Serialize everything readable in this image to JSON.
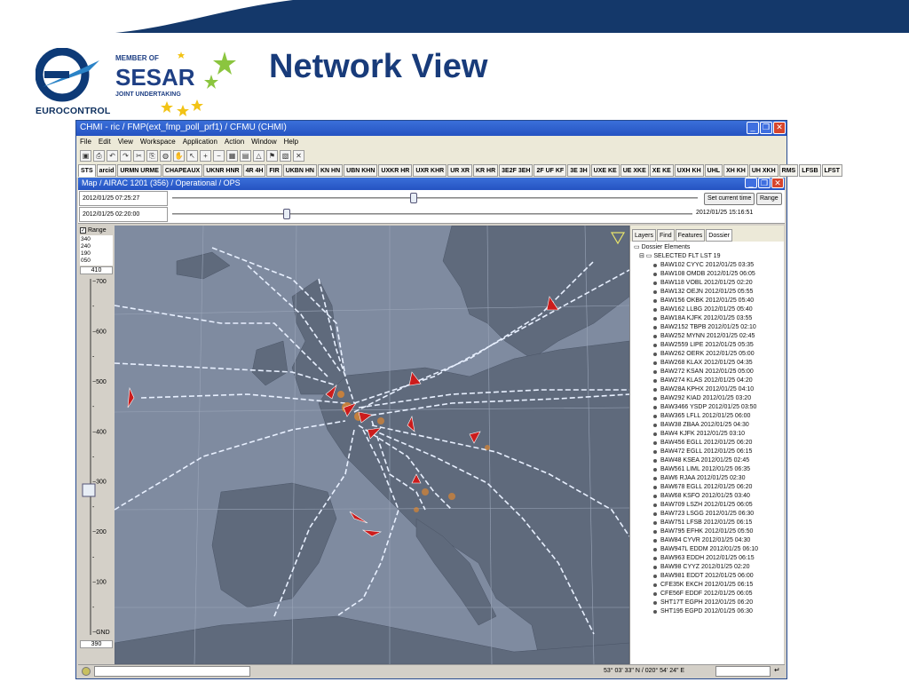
{
  "slide": {
    "title": "Network View",
    "org_name": "EUROCONTROL",
    "sesar_member_of": "MEMBER OF",
    "sesar_name": "SESAR",
    "sesar_subtitle": "JOINT UNDERTAKING"
  },
  "app": {
    "title": "CHMI - ric / FMP(ext_fmp_poll_prf1) / CFMU (CHMI)",
    "menu": [
      "File",
      "Edit",
      "View",
      "Workspace",
      "Application",
      "Action",
      "Window",
      "Help"
    ],
    "tabs": [
      "STS",
      "arcid",
      "URMN URME",
      "CHAPEAUX",
      "UKNR HNR",
      "4R 4H",
      "FIR",
      "UKBN HN",
      "KN HN",
      "UBN KHN",
      "UXKR HR",
      "UXR KHR",
      "UR XR",
      "KR HR",
      "3E2F 3EH",
      "2F UF KF",
      "3E 3H",
      "UXE KE",
      "UE XKE",
      "XE KE",
      "UXH KH",
      "UHL",
      "XH KH",
      "UH XKH",
      "RMS",
      "LFSB",
      "LFST"
    ],
    "active_tab": "STS"
  },
  "map_window": {
    "title": "Map / AIRAC 1201 (356) / Operational / OPS",
    "time_top": "2012/01/25 07:25:27",
    "time_bottom": "2012/01/25 02:20:00",
    "time_right": "2012/01/25 15:16:51",
    "slider_top_pct": 46,
    "slider_bottom_pct": 22,
    "set_time_label": "Set current time",
    "range_button_label": "Range"
  },
  "range_panel": {
    "checkbox_label": "Range",
    "levels": [
      "340",
      "240",
      "190",
      "050"
    ],
    "top_value": "410",
    "bottom_value": "390",
    "scale": [
      "700",
      "600",
      "500",
      "400",
      "300",
      "200",
      "100",
      "GND"
    ]
  },
  "side_panel": {
    "tabs": [
      "Layers",
      "Find",
      "Features",
      "Dossier"
    ],
    "active_tab": "Dossier",
    "root": "Dossier Elements",
    "group": "SELECTED FLT LST 19",
    "items": [
      "BAW102 CYYC 2012/01/25 03:35",
      "BAW108 OMDB 2012/01/25 06:05",
      "BAW118 VOBL 2012/01/25 02:20",
      "BAW132 OEJN 2012/01/25 05:55",
      "BAW156 OKBK 2012/01/25 05:40",
      "BAW162 LLBG 2012/01/25 05:40",
      "BAW18A KJFK 2012/01/25 03:55",
      "BAW2152 TBPB 2012/01/25 02:10",
      "BAW252 MYNN 2012/01/25 02:45",
      "BAW2559 LIPE 2012/01/25 05:35",
      "BAW262 OERK 2012/01/25 05:00",
      "BAW268 KLAX 2012/01/25 04:35",
      "BAW272 KSAN 2012/01/25 05:00",
      "BAW274 KLAS 2012/01/25 04:20",
      "BAW28A KPHX 2012/01/25 04:10",
      "BAW292 KIAD 2012/01/25 03:20",
      "BAW3466 YSDP 2012/01/25 03:50",
      "BAW365 LFLL 2012/01/25 06:00",
      "BAW38 ZBAA 2012/01/25 04:30",
      "BAW4 KJFK 2012/01/25 03:10",
      "BAW456 EGLL 2012/01/25 06:20",
      "BAW472 EGLL 2012/01/25 06:15",
      "BAW48 KSEA 2012/01/25 02:45",
      "BAW561 LIML 2012/01/25 06:35",
      "BAW6 RJAA 2012/01/25 02:30",
      "BAW678 EGLL 2012/01/25 06:20",
      "BAW68 KSFO 2012/01/25 03:40",
      "BAW709 LSZH 2012/01/25 06:05",
      "BAW723 LSGG 2012/01/25 06:30",
      "BAW751 LFSB 2012/01/25 06:15",
      "BAW795 EFHK 2012/01/25 05:50",
      "BAW84 CYVR 2012/01/25 04:30",
      "BAW947L EDDM 2012/01/25 06:10",
      "BAW963 EDDH 2012/01/25 06:15",
      "BAW98 CYYZ 2012/01/25 02:20",
      "BAW981 EDDT 2012/01/25 06:00",
      "CFE35K EKCH 2012/01/25 06:15",
      "CFE56F EDDF 2012/01/25 06:05",
      "SHT17T EGPH 2012/01/25 06:20",
      "SHT195 EGPD 2012/01/25 06:30"
    ]
  },
  "status": {
    "coords": "53° 03' 33\" N / 020° 54' 24\" E"
  },
  "colors": {
    "top_band": "#14386a",
    "title": "#183b7a",
    "sea": "#7f8ba0",
    "land": "#5f6a7c",
    "route": "#e8f0ff",
    "route_warning": "#f08a24",
    "aircraft": "#cc1c1c"
  }
}
